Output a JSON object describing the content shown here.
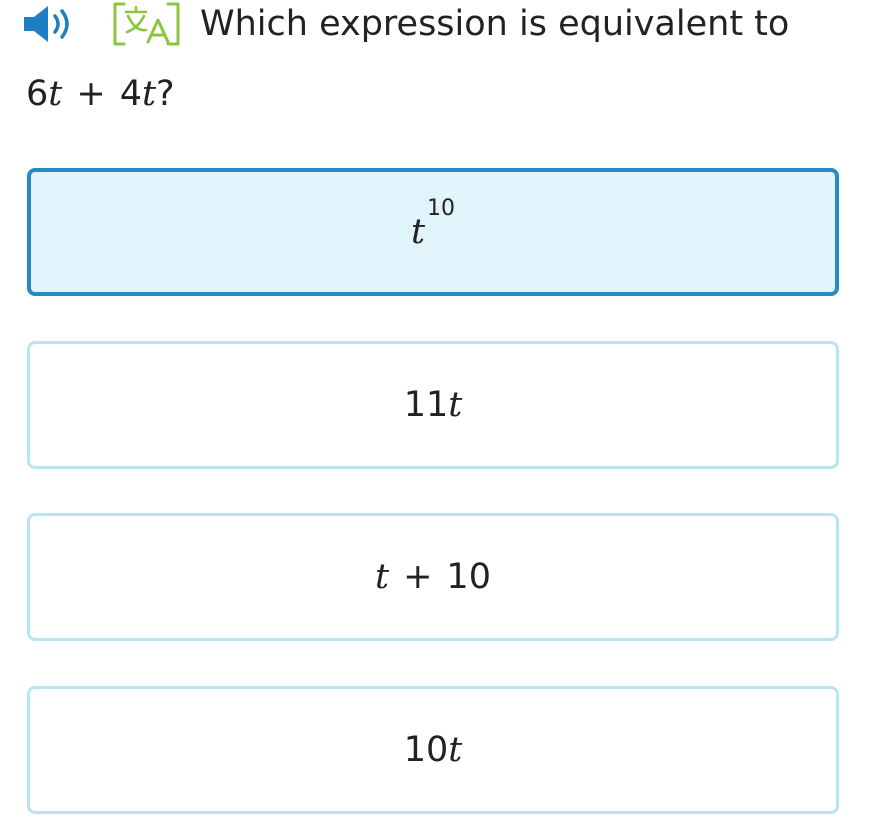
{
  "question": {
    "text": "Which expression is equivalent to",
    "expression": {
      "term1_coef": "6",
      "term1_var": "t",
      "operator": "+",
      "term2_coef": "4",
      "term2_var": "t",
      "suffix": "?"
    }
  },
  "icons": {
    "speaker": "speaker-icon",
    "translate": "translate-icon",
    "speaker_color": "#1f7ec2",
    "translate_color": "#8cc63f"
  },
  "choices": [
    {
      "base": "t",
      "exponent": "10",
      "selected": true
    },
    {
      "coef": "11",
      "var": "t",
      "selected": false
    },
    {
      "var": "t",
      "operator": "+",
      "constant": "10",
      "selected": false
    },
    {
      "coef": "10",
      "var": "t",
      "selected": false
    }
  ],
  "colors": {
    "selected_border": "#2a88c5",
    "selected_background": "#e2f4fb",
    "choice_border": "#b9e4f2"
  }
}
